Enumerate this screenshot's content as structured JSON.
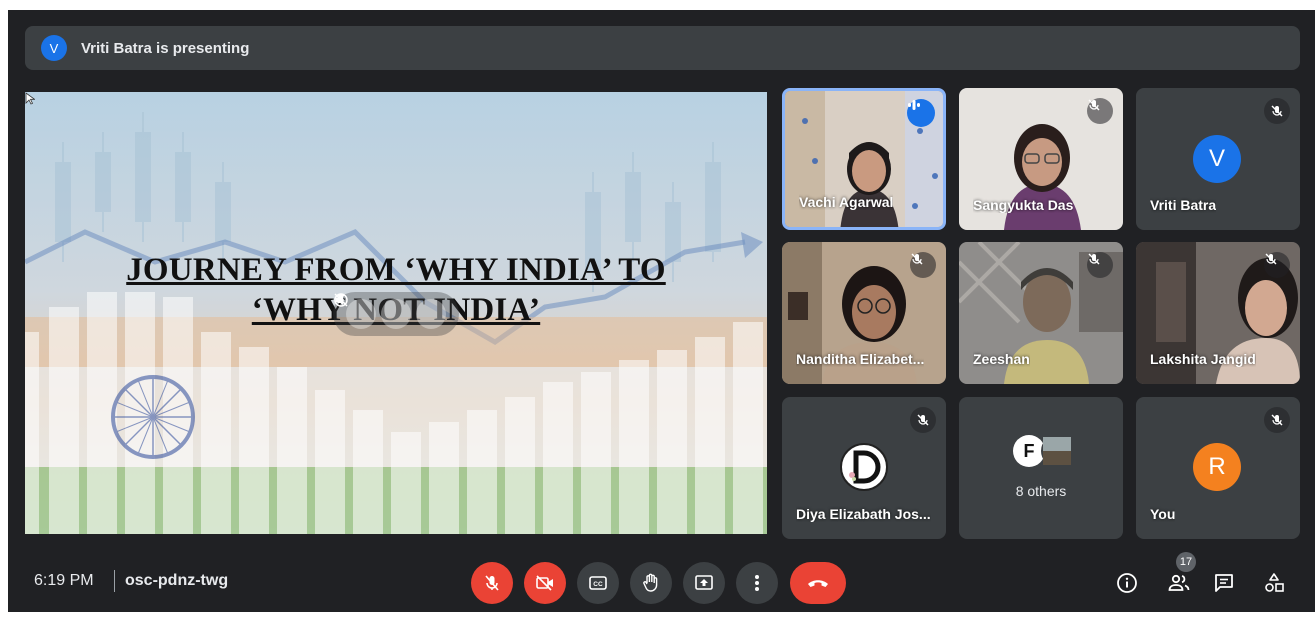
{
  "presenting": {
    "avatar_letter": "V",
    "text": "Vriti Batra is presenting"
  },
  "slide": {
    "title_line1": "JOURNEY FROM ‘WHY INDIA’ TO",
    "title_line2": "‘WHY NOT INDIA’"
  },
  "participants": [
    {
      "name": "Vachi Agarwal",
      "state": "speaking"
    },
    {
      "name": "Sangyukta Das",
      "state": "muted"
    },
    {
      "name": "Vriti Batra",
      "state": "muted",
      "avatar_letter": "V",
      "avatar_color": "#1a73e8"
    },
    {
      "name": "Nanditha Elizabet...",
      "state": "muted"
    },
    {
      "name": "Zeeshan",
      "state": "muted"
    },
    {
      "name": "Lakshita Jangid",
      "state": "muted"
    },
    {
      "name": "Diya Elizabath Jos...",
      "state": "muted",
      "avatar_letter": "D"
    },
    {
      "name": "8 others",
      "avatar_letter": "F"
    },
    {
      "name": "You",
      "state": "muted",
      "avatar_letter": "R",
      "avatar_color": "#f4811f"
    }
  ],
  "bottom_bar": {
    "time": "6:19 PM",
    "meeting_code": "osc-pdnz-twg",
    "participant_count": "17",
    "controls": [
      "mic-off-icon",
      "camera-off-icon",
      "captions-icon",
      "raise-hand-icon",
      "present-icon",
      "more-options-icon",
      "leave-call-icon"
    ],
    "right_icons": [
      "info-icon",
      "people-icon",
      "chat-icon",
      "activities-icon"
    ]
  },
  "colors": {
    "accent": "#1a73e8",
    "danger": "#ea4335",
    "surface": "#3c4043",
    "background": "#202124"
  }
}
